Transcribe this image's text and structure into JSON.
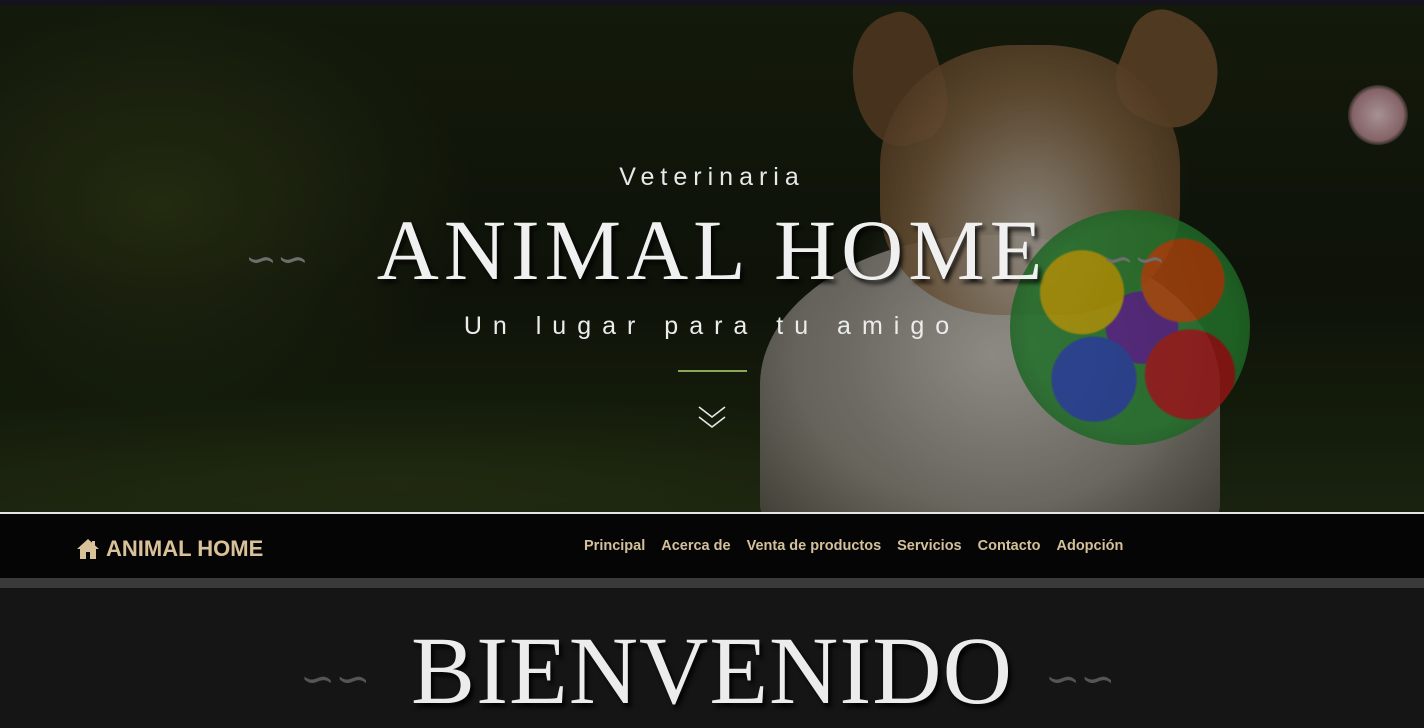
{
  "hero": {
    "subtitle": "Veterinaria",
    "title": "ANIMAL HOME",
    "tagline": "Un lugar para tu amigo",
    "divider_color": "#8ba85a",
    "scroll_icon": "double-chevron-down-icon",
    "ornament": "swirl-ornament-icon"
  },
  "navbar": {
    "brand_icon": "home-icon",
    "brand": "ANIMAL HOME",
    "brand_color": "#d9c29a",
    "items": [
      {
        "label": "Principal"
      },
      {
        "label": "Acerca de"
      },
      {
        "label": "Venta de productos"
      },
      {
        "label": "Servicios"
      },
      {
        "label": "Contacto"
      },
      {
        "label": "Adopción"
      }
    ]
  },
  "welcome": {
    "title": "BIENVENIDO"
  }
}
